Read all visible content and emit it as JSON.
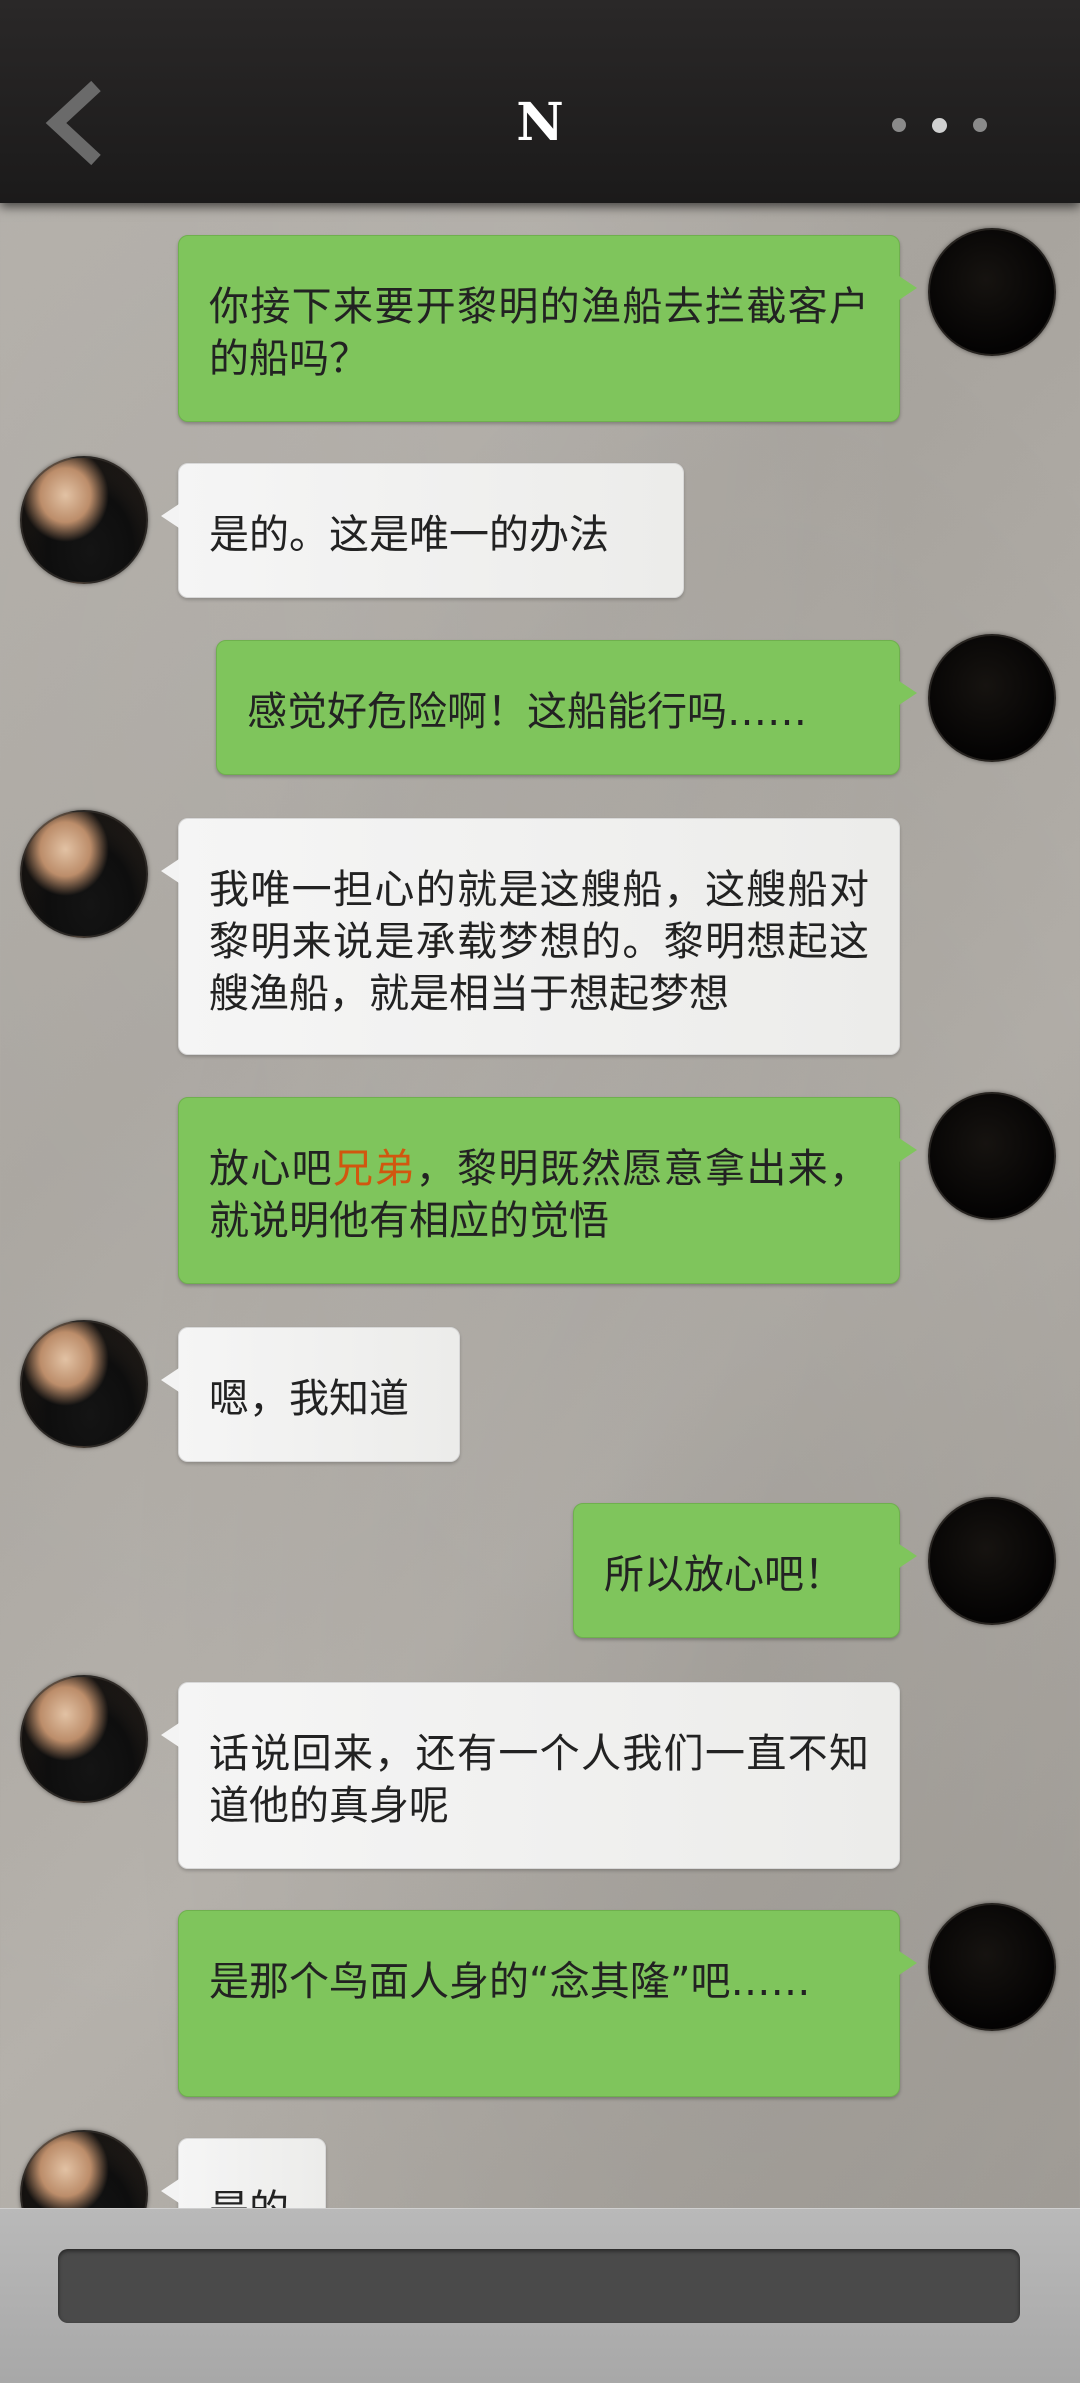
{
  "header": {
    "title": "N"
  },
  "messages": [
    {
      "side": "self",
      "text": "你接下来要开黎明的渔船去拦截客户的船吗？"
    },
    {
      "side": "other",
      "text": "是的。这是唯一的办法"
    },
    {
      "side": "self",
      "text": "感觉好危险啊！这船能行吗……"
    },
    {
      "side": "other",
      "text": "我唯一担心的就是这艘船，这艘船对黎明来说是承载梦想的。黎明想起这艘渔船，就是相当于想起梦想"
    },
    {
      "side": "self",
      "text_before": "放心吧",
      "text_highlight": "兄弟",
      "text_after": "，黎明既然愿意拿出来，就说明他有相应的觉悟"
    },
    {
      "side": "other",
      "text": "嗯，我知道"
    },
    {
      "side": "self",
      "text": "所以放心吧！"
    },
    {
      "side": "other",
      "text": "话说回来，还有一个人我们一直不知道他的真身呢"
    },
    {
      "side": "self",
      "text": "是那个鸟面人身的“念其隆”吧……"
    },
    {
      "side": "other",
      "text": "是的"
    }
  ],
  "colors": {
    "highlight": "#d1570f",
    "self_bubble": "#7fc55c",
    "other_bubble": "#f3f3f3"
  }
}
